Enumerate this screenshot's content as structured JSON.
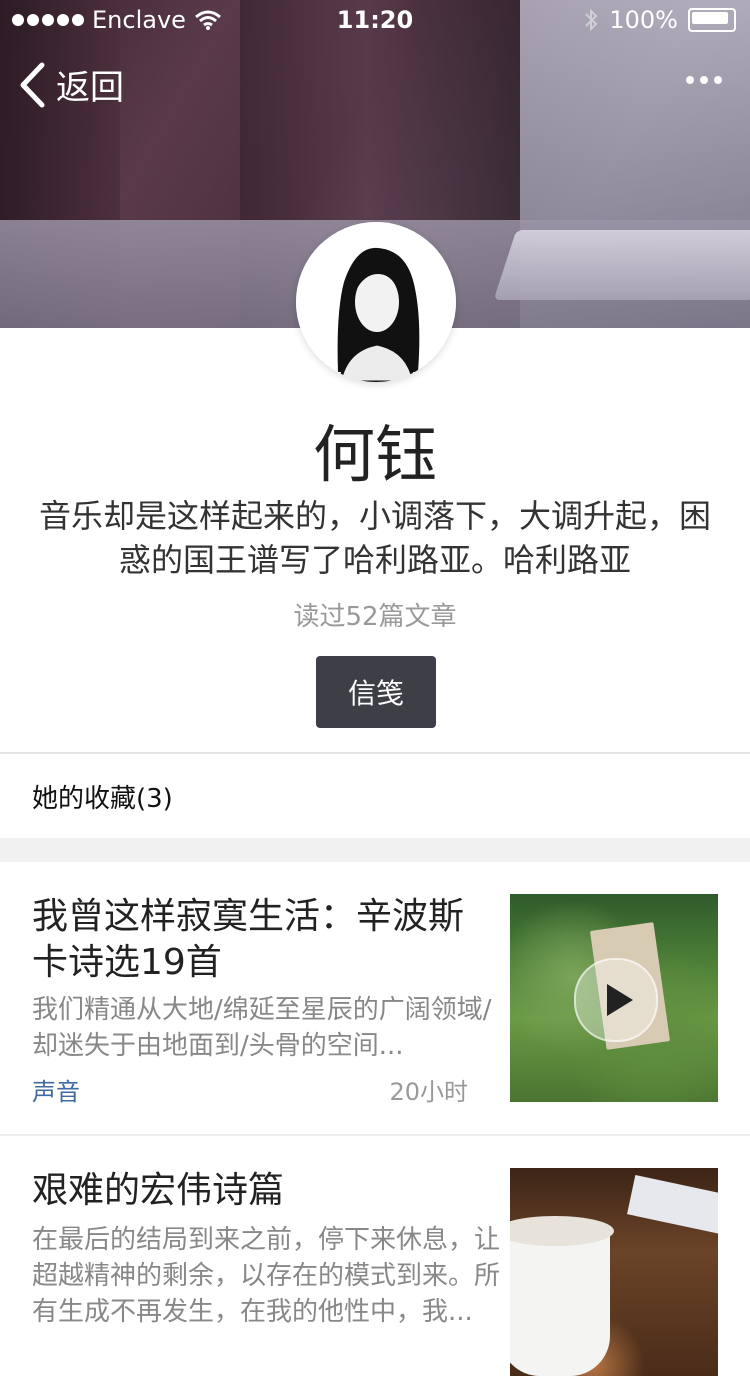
{
  "status_bar": {
    "carrier": "Enclave",
    "time": "11:20",
    "battery": "100%"
  },
  "nav": {
    "back_label": "返回"
  },
  "profile": {
    "name": "何钰",
    "bio": "音乐却是这样起来的，小调落下，大调升起，困惑的国王谱写了哈利路亚。哈利路亚",
    "read_count": "读过52篇文章",
    "letter_button": "信笺"
  },
  "collections": {
    "header": "她的收藏(3)"
  },
  "articles": [
    {
      "title": "我曾这样寂寞生活：辛波斯卡诗选19首",
      "excerpt": "我们精通从大地/绵延至星辰的广阔领域/却迷失于由地面到/头骨的空间...",
      "tag": "声音",
      "time": "20小时",
      "thumbnail_icon": "garden-sign-video-thumbnail"
    },
    {
      "title": "艰难的宏伟诗篇",
      "excerpt": "在最后的结局到来之前，停下来休息，让超越精神的剩余，以存在的模式到来。所有生成不再发生，在我的他性中，我...",
      "thumbnail_icon": "coffee-cup-thumbnail"
    }
  ],
  "colors": {
    "letter_button_bg": "#3e3f46",
    "tag_blue": "#3f6aa6",
    "muted_text": "#888888"
  }
}
